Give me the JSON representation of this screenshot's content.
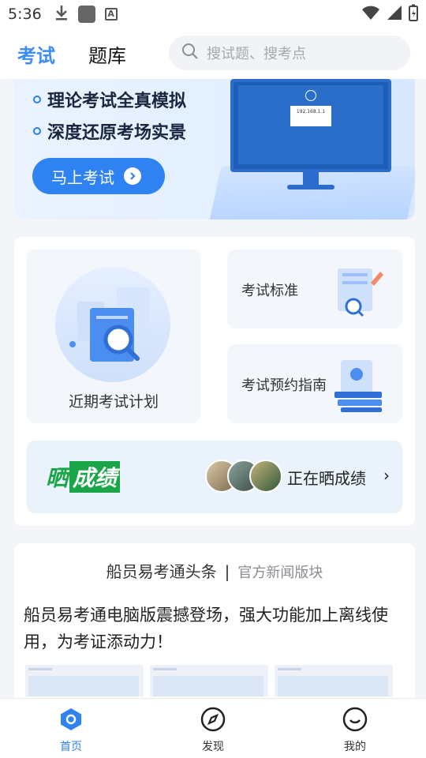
{
  "status_bar": {
    "time": "5:36",
    "icons": [
      "download-icon",
      "app-icon",
      "a-icon",
      "wifi-icon",
      "signal-icon",
      "battery-icon"
    ]
  },
  "header": {
    "tabs": [
      {
        "label": "考试",
        "active": true
      },
      {
        "label": "题库",
        "active": false
      }
    ],
    "search_placeholder": "搜试题、搜考点"
  },
  "banner": {
    "lines": [
      "理论考试全真模拟",
      "深度还原考场实景"
    ],
    "button_label": "马上考试",
    "monitor": {
      "ip": "192.168.1.1"
    }
  },
  "cards": {
    "plan_label": "近期考试计划",
    "standard_label": "考试标准",
    "guide_label": "考试预约指南"
  },
  "score": {
    "logo_part1": "晒",
    "logo_part2": "成绩",
    "text": "正在晒成绩",
    "chevron": "›"
  },
  "news": {
    "title": "船员易考通头条",
    "separator": "|",
    "subtitle": "官方新闻版块",
    "headline": "船员易考通电脑版震撼登场，强大功能加上离线使用，为考证添动力！"
  },
  "bottom_nav": [
    {
      "label": "首页",
      "icon": "home-icon",
      "active": true
    },
    {
      "label": "发现",
      "icon": "compass-icon",
      "active": false
    },
    {
      "label": "我的",
      "icon": "smile-icon",
      "active": false
    }
  ],
  "colors": {
    "accent": "#2f82f2",
    "score_green": "#1aa548"
  }
}
